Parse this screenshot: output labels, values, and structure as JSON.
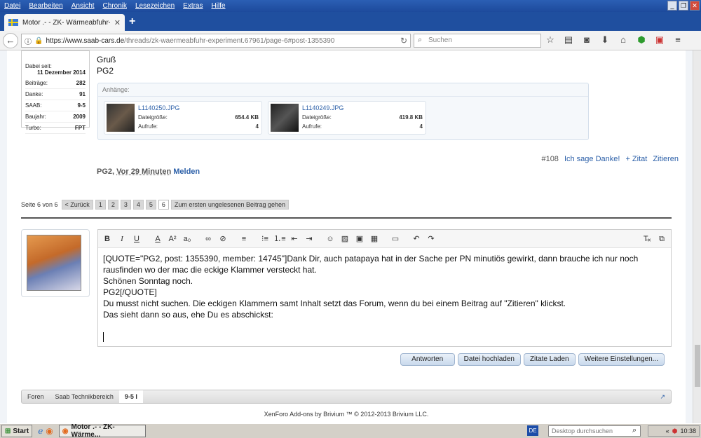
{
  "menu": [
    "Datei",
    "Bearbeiten",
    "Ansicht",
    "Chronik",
    "Lesezeichen",
    "Extras",
    "Hilfe"
  ],
  "tab": {
    "title": "Motor .- - ZK- Wärmeabfuhr- ...",
    "new_tab": "+"
  },
  "nav": {
    "url_host": "https://www.saab-cars.de",
    "url_path": "/threads/zk-waermeabfuhr-experiment.67961/page-6#post-1355390",
    "search_placeholder": "Suchen"
  },
  "userbox": {
    "joined_label": "Dabei seit:",
    "joined_value": "11 Dezember 2014",
    "rows": [
      {
        "k": "Beiträge:",
        "v": "282"
      },
      {
        "k": "Danke:",
        "v": "91"
      },
      {
        "k": "SAAB:",
        "v": "9-5"
      },
      {
        "k": "Baujahr:",
        "v": "2009"
      },
      {
        "k": "Turbo:",
        "v": "FPT"
      }
    ]
  },
  "post": {
    "line1": "Gruß",
    "line2": "PG2",
    "attachments_label": "Anhänge:",
    "attachments": [
      {
        "name": "L1140250.JPG",
        "size_label": "Dateigröße:",
        "size": "654.4 KB",
        "views_label": "Aufrufe:",
        "views": "4"
      },
      {
        "name": "L1140249.JPG",
        "size_label": "Dateigröße:",
        "size": "419.8 KB",
        "views_label": "Aufrufe:",
        "views": "4"
      }
    ],
    "number": "#108",
    "thanks": "Ich sage Danke!",
    "quote_plus": "+ Zitat",
    "quote": "Zitieren",
    "author": "PG2,",
    "ago": "Vor 29 Minuten",
    "report": "Melden"
  },
  "pagination": {
    "label": "Seite 6 von 6",
    "back": "< Zurück",
    "pages": [
      "1",
      "2",
      "3",
      "4",
      "5"
    ],
    "current": "6",
    "unread": "Zum ersten ungelesenen Beitrag gehen"
  },
  "editor": {
    "lines": [
      "[QUOTE=\"PG2, post: 1355390, member: 14745\"]Dank Dir, auch patapaya hat in der Sache per PN minutiös gewirkt, dann brauche ich nur noch rausfinden wo der mac die eckige Klammer versteckt hat.",
      "Schönen Sonntag noch.",
      "PG2[/QUOTE]",
      "Du musst nicht suchen. Die eckigen Klammern samt Inhalt setzt das Forum, wenn du bei einem Beitrag auf \"Zitieren\" klickst.",
      "Das sieht dann so aus, ehe Du es abschickst:"
    ],
    "buttons": [
      "Antworten",
      "Datei hochladen",
      "Zitate Laden",
      "Weitere Einstellungen..."
    ]
  },
  "breadcrumb": [
    "Foren",
    "Saab Technikbereich",
    "9-5 I"
  ],
  "footer": "XenForo Add-ons by Brivium ™ © 2012-2013 Brivium LLC.",
  "taskbar": {
    "start": "Start",
    "window": "Motor .- - ZK- Wärme...",
    "lang": "DE",
    "search_placeholder": "Desktop durchsuchen",
    "time": "10:38"
  }
}
